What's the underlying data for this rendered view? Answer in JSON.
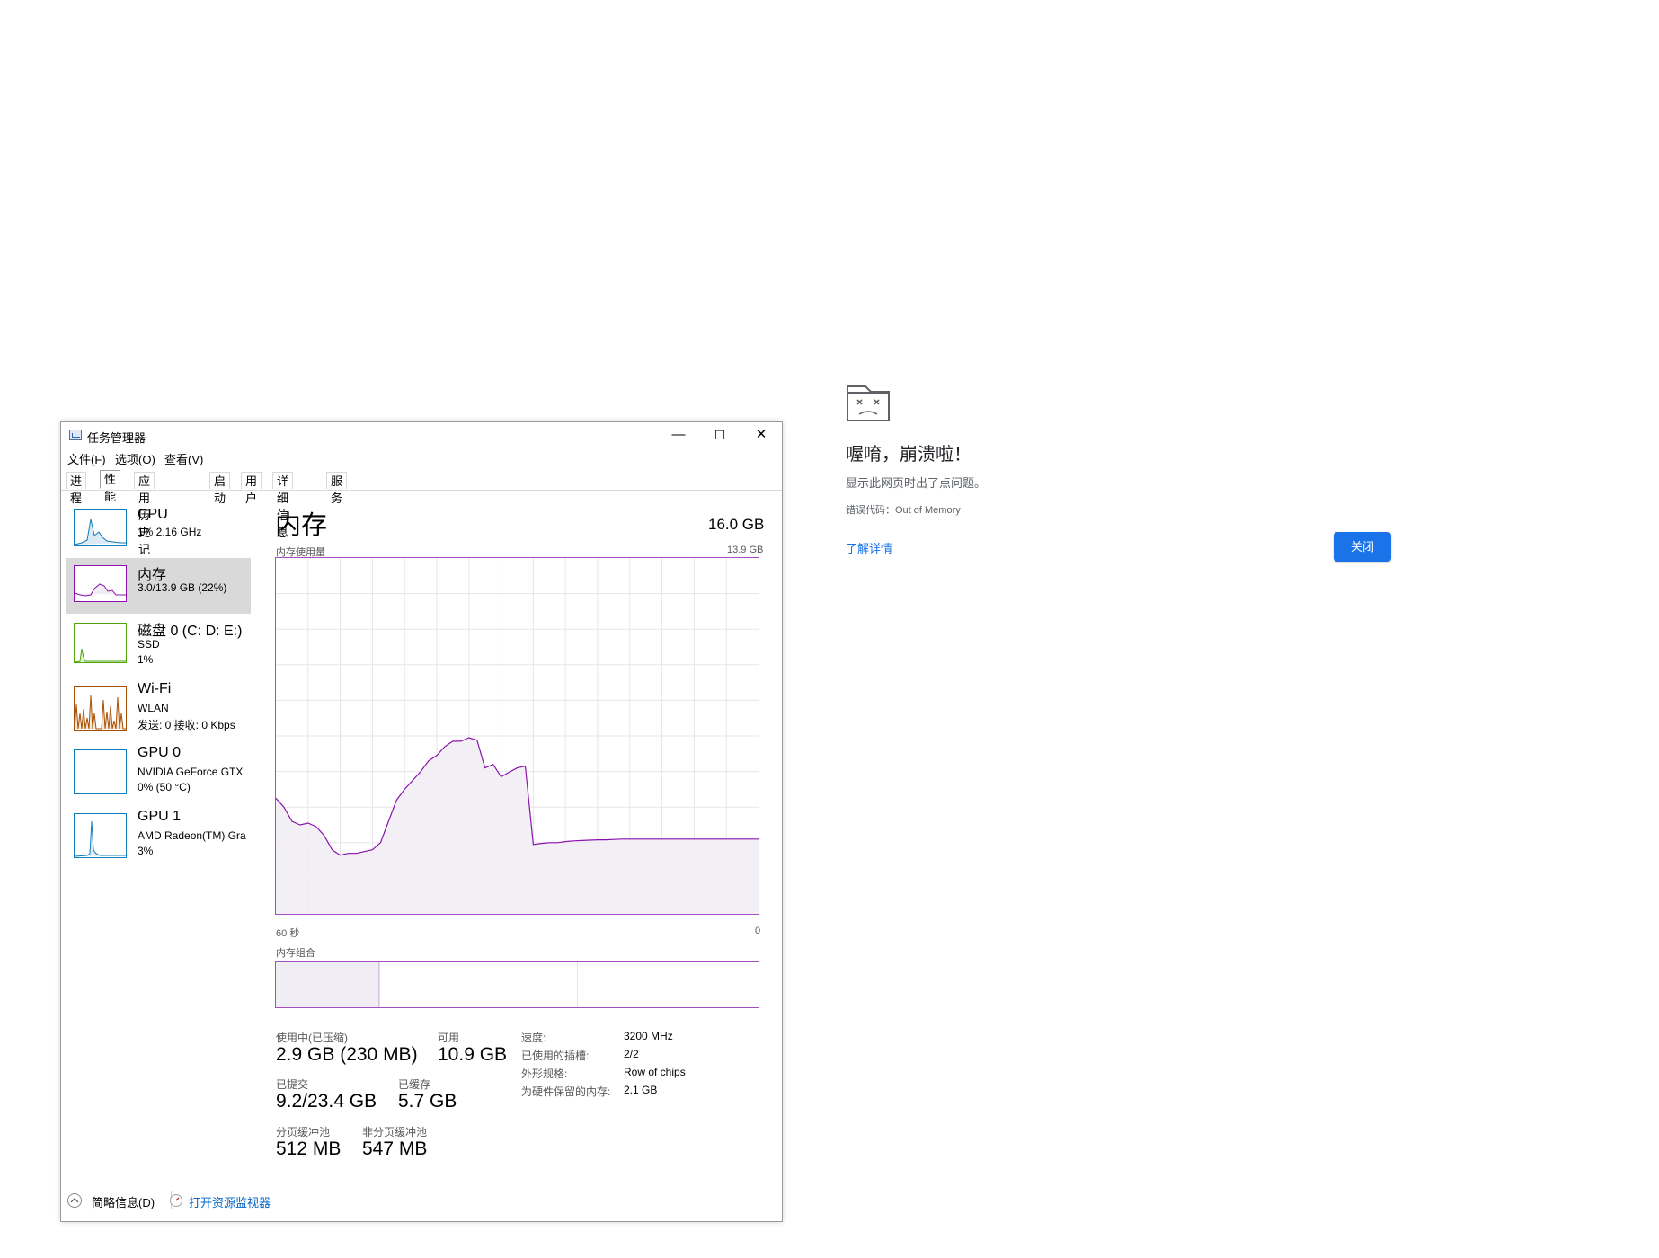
{
  "window": {
    "title": "任务管理器",
    "controls": {
      "minimize": "—",
      "maximize": "☐",
      "close": "✕"
    }
  },
  "menu": [
    "文件(F)",
    "选项(O)",
    "查看(V)"
  ],
  "tabs": [
    "进程",
    "性能",
    "应用历史记录",
    "启动",
    "用户",
    "详细信息",
    "服务"
  ],
  "active_tab": 1,
  "sidebar": [
    {
      "name": "CPU",
      "lines": [
        "1% 2.16 GHz"
      ],
      "color": "#117dbb"
    },
    {
      "name": "内存",
      "lines": [
        "3.0/13.9 GB (22%)"
      ],
      "color": "#8b12ae",
      "selected": true
    },
    {
      "name": "磁盘 0 (C: D: E:)",
      "lines": [
        "SSD",
        "1%"
      ],
      "color": "#4da60c"
    },
    {
      "name": "Wi-Fi",
      "lines": [
        "WLAN",
        "发送: 0 接收: 0 Kbps"
      ],
      "color": "#a74f01"
    },
    {
      "name": "GPU 0",
      "lines": [
        "NVIDIA GeForce GTX",
        "0% (50 °C)"
      ],
      "color": "#117dbb"
    },
    {
      "name": "GPU 1",
      "lines": [
        "AMD Radeon(TM) Gra",
        "3%"
      ],
      "color": "#117dbb"
    }
  ],
  "main": {
    "title": "内存",
    "total": "16.0 GB",
    "usage_label": "内存使用量",
    "usage_max": "13.9 GB",
    "x_left": "60 秒",
    "x_right": "0",
    "composition_label": "内存组合",
    "accent": "#8b12ae"
  },
  "chart_data": {
    "type": "area",
    "x": [
      60,
      59,
      58,
      57,
      56,
      55,
      54,
      53,
      52,
      51,
      50,
      49,
      48,
      47,
      46,
      45,
      44,
      43,
      42,
      41,
      40,
      39,
      38,
      37,
      36,
      35,
      34,
      33,
      32,
      31,
      30,
      29,
      28,
      27,
      26,
      25,
      24,
      23,
      22,
      21,
      20,
      19,
      18,
      17,
      16,
      15,
      14,
      13,
      12,
      11,
      10,
      9,
      8,
      7,
      6,
      5,
      4,
      3,
      2,
      1,
      0
    ],
    "values": [
      32.5,
      30,
      26,
      25,
      25.5,
      24.5,
      22,
      18,
      16.5,
      17,
      17,
      17.5,
      18,
      20,
      26,
      32,
      35,
      37.5,
      40,
      43,
      44.5,
      47,
      48.5,
      48.5,
      49.5,
      48.8,
      41,
      42,
      38.5,
      39.8,
      41,
      41.5,
      19.5,
      19.8,
      20,
      20,
      20.3,
      20.5,
      20.6,
      20.7,
      20.8,
      20.8,
      20.9,
      21,
      21,
      21,
      21,
      21,
      21,
      21,
      21,
      21,
      21,
      21,
      21,
      21,
      21,
      21,
      21,
      21,
      21
    ],
    "ylim": [
      0,
      100
    ],
    "xlim": [
      60,
      0
    ]
  },
  "composition": [
    {
      "fraction": 0.215,
      "fill": "#f1edf4"
    },
    {
      "fraction": 0.41,
      "fill": "#ffffff"
    },
    {
      "fraction": 0.375,
      "fill": "#ffffff"
    }
  ],
  "stats": {
    "in_use_label": "使用中(已压缩)",
    "in_use": "2.9 GB (230 MB)",
    "available_label": "可用",
    "available": "10.9 GB",
    "committed_label": "已提交",
    "committed": "9.2/23.4 GB",
    "cached_label": "已缓存",
    "cached": "5.7 GB",
    "paged_label": "分页缓冲池",
    "paged": "512 MB",
    "nonpaged_label": "非分页缓冲池",
    "nonpaged": "547 MB"
  },
  "details": [
    {
      "key": "速度:",
      "value": "3200 MHz"
    },
    {
      "key": "已使用的插槽:",
      "value": "2/2"
    },
    {
      "key": "外形规格:",
      "value": "Row of chips"
    },
    {
      "key": "为硬件保留的内存:",
      "value": "2.1 GB"
    }
  ],
  "footer": {
    "brief": "简略信息(D)",
    "monitor": "打开资源监视器"
  },
  "crash": {
    "title": "喔唷，崩溃啦！",
    "description": "显示此网页时出了点问题。",
    "error_code": "错误代码：Out of Memory",
    "learn_more": "了解详情",
    "close": "关闭"
  }
}
